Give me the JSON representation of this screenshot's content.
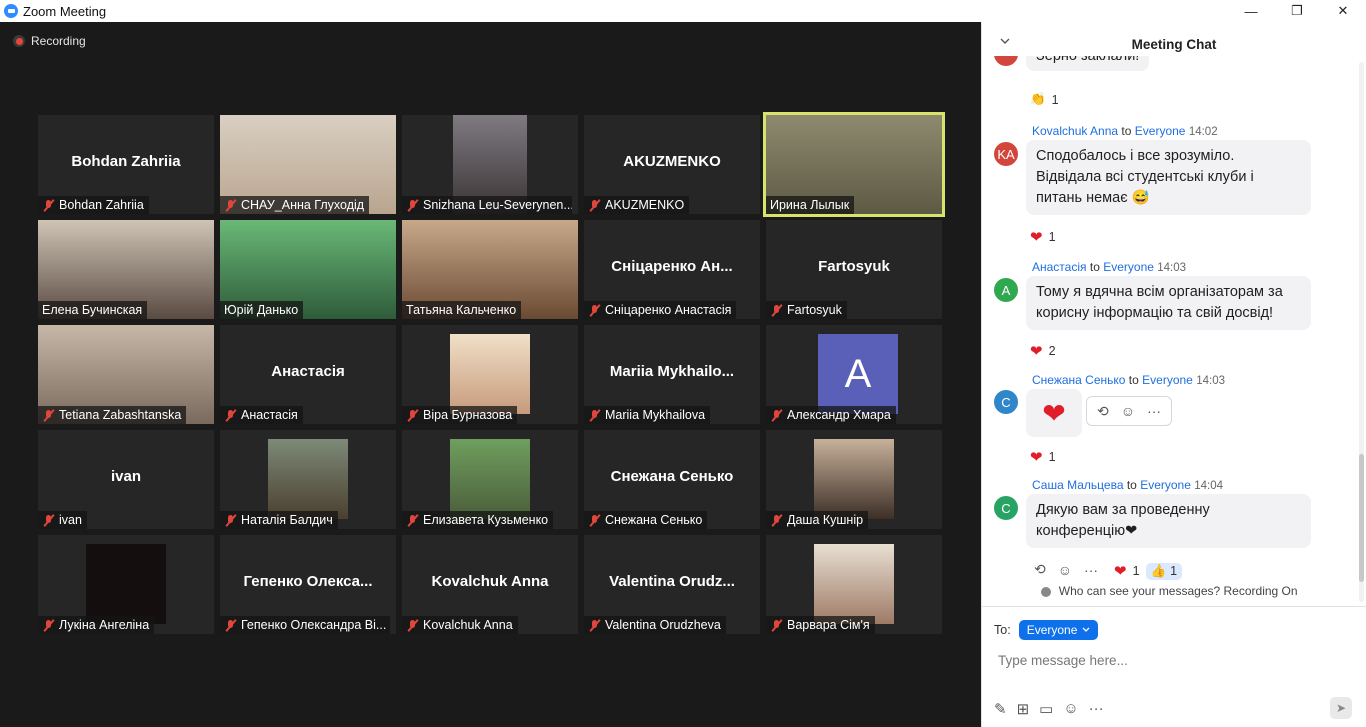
{
  "window": {
    "title": "Zoom Meeting",
    "minimize": "—",
    "maximize": "❐",
    "close": "✕"
  },
  "recording": {
    "label": "Recording"
  },
  "tiles": [
    {
      "name": "Bohdan Zahriia",
      "label": "Bohdan Zahriia",
      "muted": true
    },
    {
      "name": "",
      "label": "СНАУ_Анна Глуходід",
      "muted": true
    },
    {
      "name": "",
      "label": "Snizhana Leu-Severynen...",
      "muted": true
    },
    {
      "name": "AKUZMENKO",
      "label": "AKUZMENKO",
      "muted": true
    },
    {
      "name": "",
      "label": "Ирина Лылык",
      "muted": false
    },
    {
      "name": "",
      "label": "Елена Бучинская",
      "muted": false
    },
    {
      "name": "",
      "label": "Юрій Данько",
      "muted": false
    },
    {
      "name": "",
      "label": "Татьяна Кальченко",
      "muted": false
    },
    {
      "name": "Сніцаренко Ан...",
      "label": "Сніцаренко Анастасія",
      "muted": true
    },
    {
      "name": "Fartosyuk",
      "label": "Fartosyuk",
      "muted": true
    },
    {
      "name": "",
      "label": "Tetiana Zabashtanska",
      "muted": true
    },
    {
      "name": "Анастасія",
      "label": "Анастасія",
      "muted": true
    },
    {
      "name": "",
      "label": "Віра Бурназова",
      "muted": true
    },
    {
      "name": "Mariia Mykhailo...",
      "label": "Mariia Mykhailova",
      "muted": true
    },
    {
      "name": "",
      "label": "Александр Хмара",
      "muted": true
    },
    {
      "name": "ivan",
      "label": "ivan",
      "muted": true
    },
    {
      "name": "",
      "label": "Наталія Балдич",
      "muted": true
    },
    {
      "name": "",
      "label": "Елизавета Кузьменко",
      "muted": true
    },
    {
      "name": "Снежана Сенько",
      "label": "Снежана Сенько",
      "muted": true
    },
    {
      "name": "",
      "label": "Даша Кушнір",
      "muted": true
    },
    {
      "name": "",
      "label": "Лукіна Ангеліна",
      "muted": true
    },
    {
      "name": "Гепенко Олекса...",
      "label": "Гепенко Олександра Ві...",
      "muted": true
    },
    {
      "name": "Kovalchuk Anna",
      "label": "Kovalchuk Anna",
      "muted": true
    },
    {
      "name": "Valentina Orudz...",
      "label": "Valentina Orudzheva",
      "muted": true
    },
    {
      "name": "",
      "label": "Варвара Сім'я",
      "muted": true
    }
  ],
  "avatar_letter": "A",
  "chat": {
    "title": "Meeting Chat",
    "partial_message": "Зерно заклали!",
    "partial_reaction": {
      "emoji": "👏",
      "count": "1"
    },
    "messages": [
      {
        "initials": "KA",
        "avatar_color": "#d2463c",
        "sender": "Kovalchuk Anna",
        "to": "to",
        "recipient": "Everyone",
        "time": "14:02",
        "lines": [
          "Сподобалось і все зрозуміло.",
          "Відвідала всі студентські клуби і",
          "питань немає 😅"
        ],
        "reaction": "❤",
        "reaction_count": "1"
      },
      {
        "initials": "A",
        "avatar_color": "#2fa84f",
        "sender": "Анастасія",
        "to": "to",
        "recipient": "Everyone",
        "time": "14:03",
        "lines": [
          "Тому я вдячна всім організаторам за",
          "корисну інформацію та свій досвід!"
        ],
        "reaction": "❤",
        "reaction_count": "2"
      },
      {
        "initials": "С",
        "avatar_color": "#2f86c8",
        "sender": "Снежана Сенько",
        "to": "to",
        "recipient": "Everyone",
        "time": "14:03",
        "lines": [
          "❤"
        ],
        "reaction": "❤",
        "reaction_count": "1"
      },
      {
        "initials": "С",
        "avatar_color": "#27a464",
        "sender": "Саша Мальцева",
        "to": "to",
        "recipient": "Everyone",
        "time": "14:04",
        "lines": [
          "Дякую вам за проведенну",
          "конференцію❤"
        ],
        "reaction": "❤",
        "reaction_count": "1",
        "reaction2": "👍",
        "reaction2_count": "1"
      }
    ],
    "visibility_text": "Who can see your messages? Recording On",
    "to_label": "To:",
    "recipient_button": "Everyone",
    "input_placeholder": "Type message here..."
  }
}
